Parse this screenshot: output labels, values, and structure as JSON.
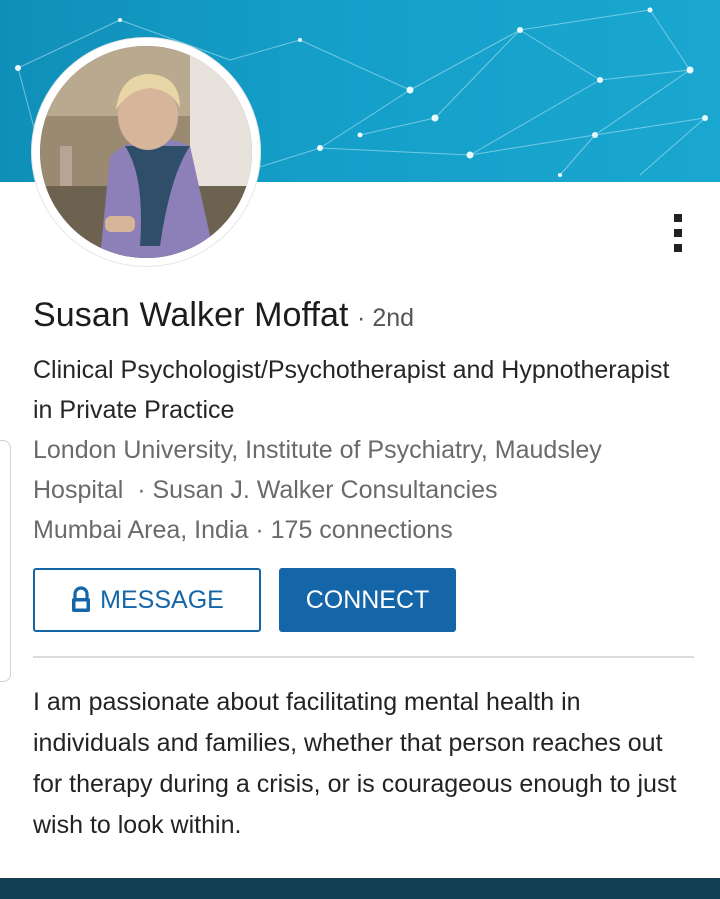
{
  "profile": {
    "name": "Susan Walker Moffat",
    "degree": "· 2nd",
    "headline": "Clinical Psychologist/Psychotherapist and Hypnotherapist in Private Practice",
    "education": "London University, Institute of Psychiatry, Maudsley Hospital",
    "company": "· Susan J. Walker Consultancies",
    "location": "Mumbai Area, India",
    "connections": "· 175 connections",
    "summary": "I am passionate about facilitating mental health in individuals and families, whether that person reaches out for therapy during a crisis, or is courageous enough to just wish to look within."
  },
  "actions": {
    "message_label": "MESSAGE",
    "connect_label": "CONNECT"
  },
  "icons": {
    "more": "more-vertical-icon",
    "lock": "lock-icon"
  },
  "colors": {
    "brand_blue": "#1566a8",
    "banner": "#149fc9",
    "bottom_bar": "#123e52"
  }
}
